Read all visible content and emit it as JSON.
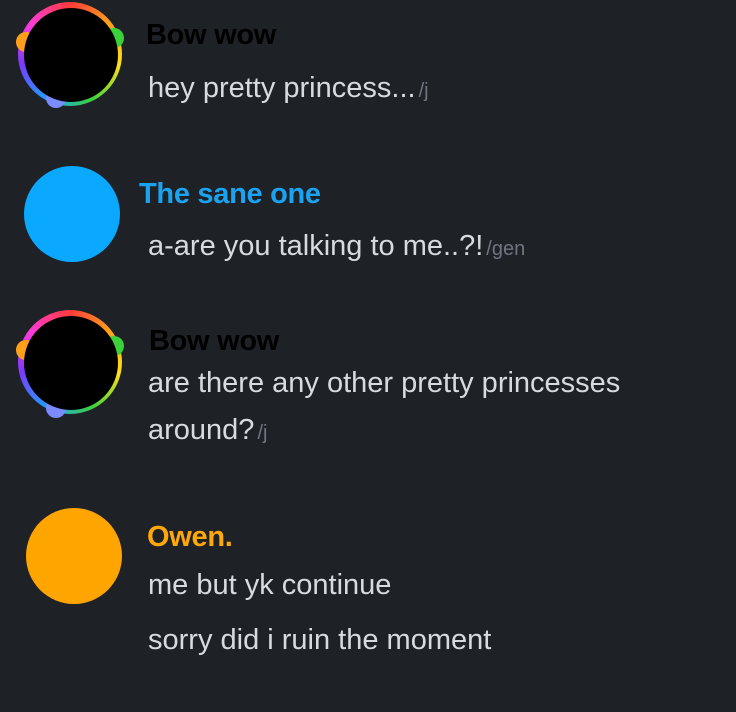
{
  "colors": {
    "background": "#1e2126",
    "message_text": "#d7dade",
    "tone_tag": "#6f7580",
    "bow_wow_name": "#000000",
    "sane_one_name": "#1aa3f0",
    "owen_name": "#ffa80a",
    "sane_one_avatar": "#0aa8ff",
    "owen_avatar": "#ffa500"
  },
  "messages": [
    {
      "author": "Bow wow",
      "lines": [
        {
          "text": "hey pretty princess...",
          "tone": "/j"
        }
      ]
    },
    {
      "author": "The sane one",
      "lines": [
        {
          "text": "a-are you talking to me..?!",
          "tone": "/gen"
        }
      ]
    },
    {
      "author": "Bow wow",
      "lines": [
        {
          "text": "are there any other pretty princesses",
          "tone": ""
        },
        {
          "text": "around?",
          "tone": "/j"
        }
      ]
    },
    {
      "author": "Owen.",
      "lines": [
        {
          "text": "me but yk continue",
          "tone": ""
        },
        {
          "text": "sorry did i ruin the moment",
          "tone": ""
        }
      ]
    }
  ]
}
